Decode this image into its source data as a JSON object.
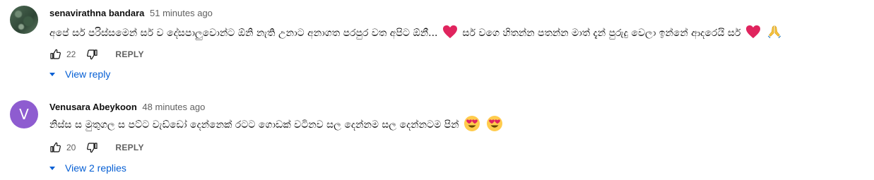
{
  "comments": [
    {
      "author": "senavirathna bandara",
      "time": "51 minutes ago",
      "text_1": "අපේ සර් පරිස්සමෙන් සර් ව දේසපාලුවොන්ට ඕනි නැති උනාට අනාගත පරපුර වත අපිට ඕනී...",
      "text_2": "සර් වගෙ හිතන්න පතන්න මාත් දැන් පුරුදු වෙලා ඉන්නේ ආදරෙයි සර්",
      "likes": "22",
      "reply_label": "REPLY",
      "view_label": "View reply",
      "avatar_icon": "profile-photo"
    },
    {
      "author": "Venusara Abeykoon",
      "time": "48 minutes ago",
      "text_1": "නිස්ස ස මුතුගල ස පට්ට වැඩ්ඩෝ දෙන්නෙක් රටට ගොඩක් වටිනව සල දෙන්නම සල දෙන්නටම පින්",
      "likes": "20",
      "reply_label": "REPLY",
      "view_label": "View 2 replies",
      "avatar_letter": "V",
      "avatar_color": "#8e5cd0"
    }
  ],
  "colors": {
    "link": "#065fd4",
    "muted": "#606060",
    "heart": "#e0245e"
  }
}
